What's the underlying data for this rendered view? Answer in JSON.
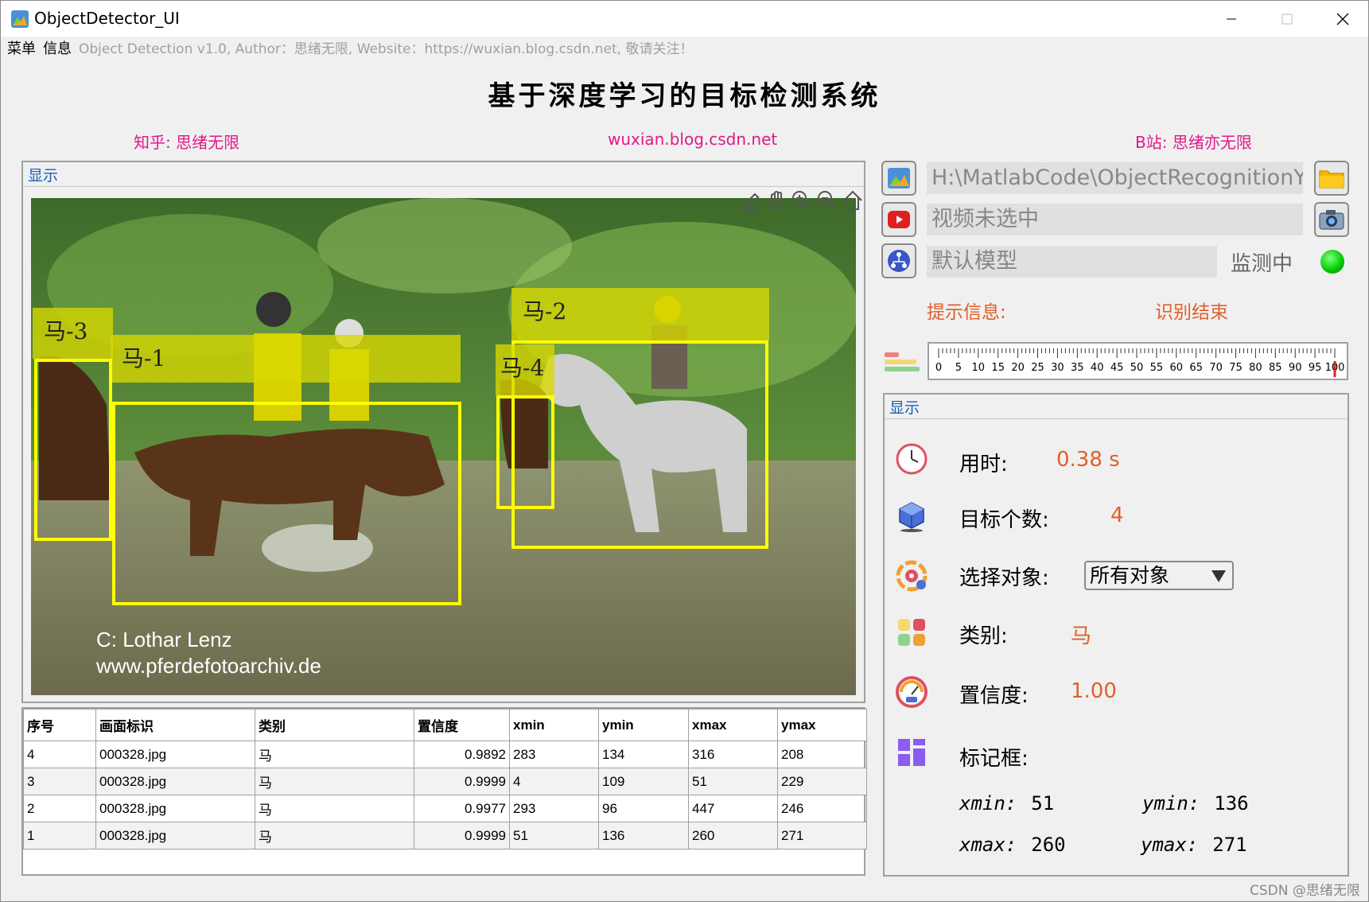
{
  "window": {
    "title": "ObjectDetector_UI"
  },
  "menubar": {
    "menu_label": "菜单",
    "info_label": "信息",
    "info_text": "Object Detection v1.0, Author：思绪无限, Website：https://wuxian.blog.csdn.net, 敬请关注！"
  },
  "header": {
    "title": "基于深度学习的目标检测系统",
    "zhihu": "知乎: 思绪无限",
    "blog": "wuxian.blog.csdn.net",
    "bili": "B站: 思绪亦无限"
  },
  "display_panel": {
    "title": "显示",
    "watermark_line1": "C:   Lothar Lenz",
    "watermark_line2": "www.pferdefotoarchiv.de",
    "detections": [
      {
        "label": "马-1"
      },
      {
        "label": "马-2"
      },
      {
        "label": "马-3"
      },
      {
        "label": "马-4"
      }
    ]
  },
  "results_table": {
    "columns": [
      "序号",
      "画面标识",
      "类别",
      "置信度",
      "xmin",
      "ymin",
      "xmax",
      "ymax"
    ],
    "rows": [
      [
        "4",
        "000328.jpg",
        "马",
        "0.9892",
        "283",
        "134",
        "316",
        "208"
      ],
      [
        "3",
        "000328.jpg",
        "马",
        "0.9999",
        "4",
        "109",
        "51",
        "229"
      ],
      [
        "2",
        "000328.jpg",
        "马",
        "0.9977",
        "293",
        "96",
        "447",
        "246"
      ],
      [
        "1",
        "000328.jpg",
        "马",
        "0.9999",
        "51",
        "136",
        "260",
        "271"
      ]
    ]
  },
  "controls": {
    "image_path": "H:\\MatlabCode\\ObjectRecognitionY…",
    "video_field": "视频未选中",
    "model_field": "默认模型",
    "status_label": "监测中",
    "status_color": "#00c800",
    "hint_label": "提示信息:",
    "hint_value": "识别结束",
    "progress_ticks": [
      "0",
      "5",
      "10",
      "15",
      "20",
      "25",
      "30",
      "35",
      "40",
      "45",
      "50",
      "55",
      "60",
      "65",
      "70",
      "75",
      "80",
      "85",
      "90",
      "95",
      "100"
    ],
    "progress_value": 100
  },
  "info_panel": {
    "title": "显示",
    "time_label": "用时:",
    "time_value": "0.38 s",
    "count_label": "目标个数:",
    "count_value": "4",
    "select_label": "选择对象:",
    "select_value": "所有对象",
    "class_label": "类别:",
    "class_value": "马",
    "conf_label": "置信度:",
    "conf_value": "1.00",
    "box_label": "标记框:",
    "xmin_key": "xmin:",
    "xmin_val": "51",
    "ymin_key": "ymin:",
    "ymin_val": "136",
    "xmax_key": "xmax:",
    "xmax_val": "260",
    "ymax_key": "ymax:",
    "ymax_val": "271"
  },
  "footer": {
    "csdn": "CSDN @思绪无限"
  },
  "colors": {
    "accent_orange": "#e0602a",
    "link_pink": "#e0198a",
    "panel_title_blue": "#1a5fb4",
    "box_yellow": "#ffff00"
  }
}
